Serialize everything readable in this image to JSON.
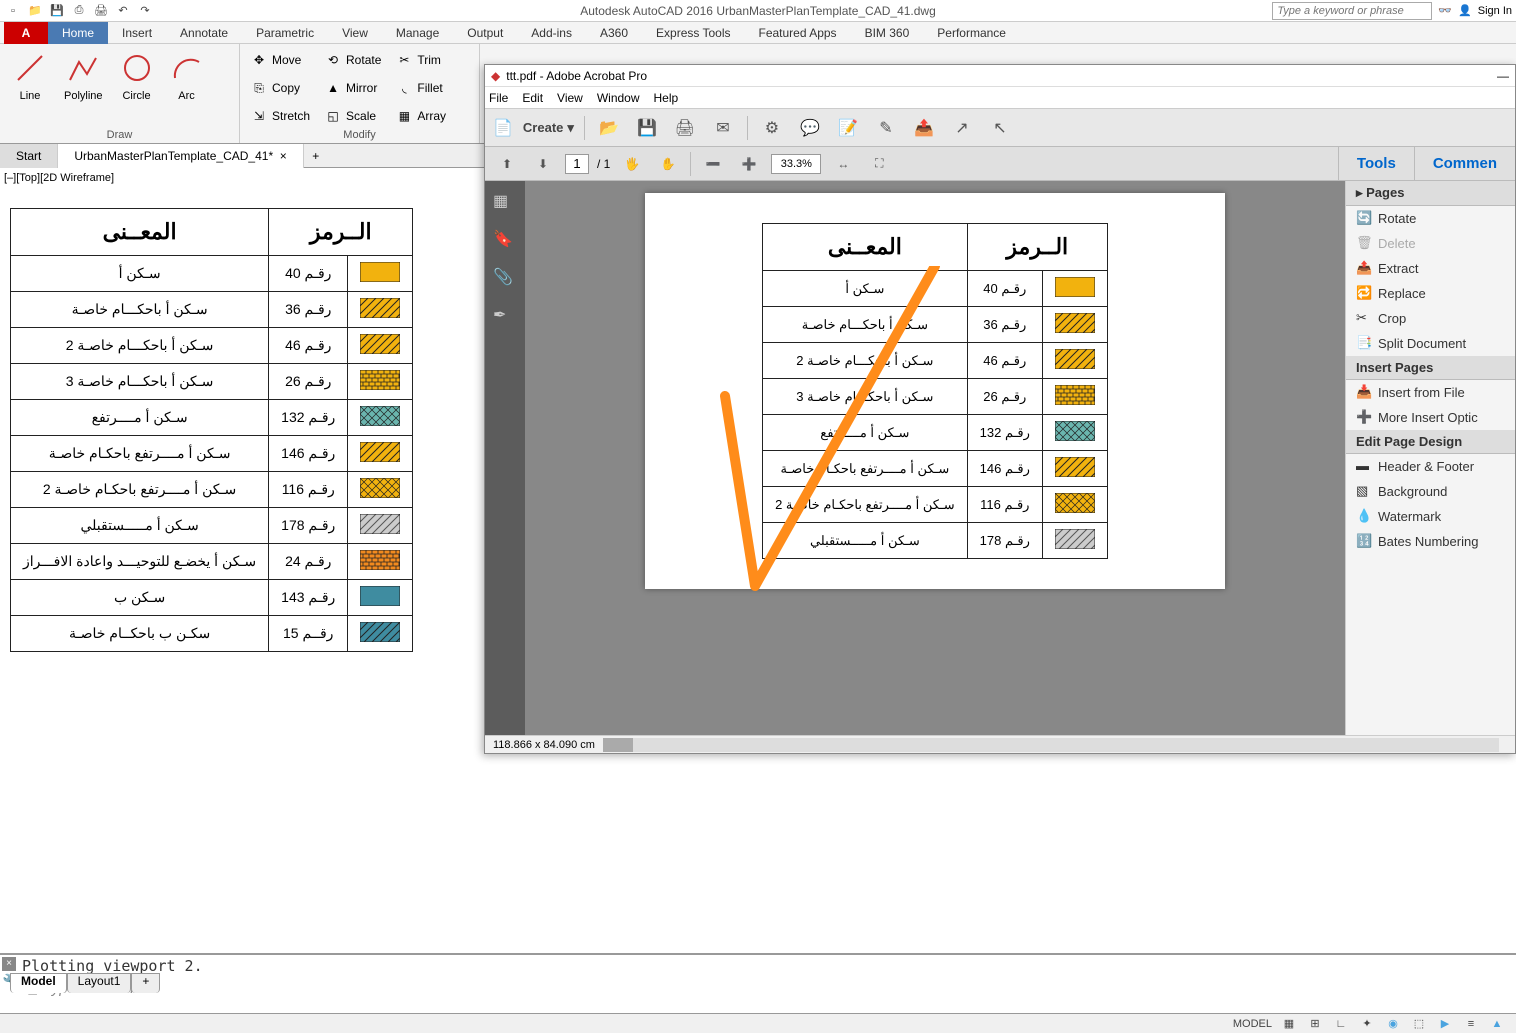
{
  "app": {
    "title": "Autodesk AutoCAD 2016   UrbanMasterPlanTemplate_CAD_41.dwg",
    "search_placeholder": "Type a keyword or phrase",
    "signin": "Sign In"
  },
  "ribbon": {
    "tabs": [
      "Home",
      "Insert",
      "Annotate",
      "Parametric",
      "View",
      "Manage",
      "Output",
      "Add-ins",
      "A360",
      "Express Tools",
      "Featured Apps",
      "BIM 360",
      "Performance"
    ],
    "draw": {
      "line": "Line",
      "polyline": "Polyline",
      "circle": "Circle",
      "arc": "Arc",
      "label": "Draw"
    },
    "modify": {
      "move": "Move",
      "rotate": "Rotate",
      "trim": "Trim",
      "copy": "Copy",
      "mirror": "Mirror",
      "fillet": "Fillet",
      "stretch": "Stretch",
      "scale": "Scale",
      "array": "Array",
      "label": "Modify"
    }
  },
  "files": {
    "start": "Start",
    "doc": "UrbanMasterPlanTemplate_CAD_41*"
  },
  "ucs": "[‒][Top][2D Wireframe]",
  "legend": {
    "h_meaning": "المعــنى",
    "h_symbol": "الــرمز",
    "rows": [
      {
        "m": "سـكن أ",
        "c": "رقـم 40",
        "sw": "#f2b20e"
      },
      {
        "m": "سـكن أ  باحكـــام خاصـة",
        "c": "رقـم 36",
        "sw": "hatch-yellow"
      },
      {
        "m": "سـكن أ  باحكـــام خاصـة 2",
        "c": "رقـم 46",
        "sw": "hatch-yellow"
      },
      {
        "m": "سـكن أ  باحكـــام خاصـة 3",
        "c": "رقـم 26",
        "sw": "brick-yellow"
      },
      {
        "m": "سـكن أ مــــرتفع",
        "c": "رقـم 132",
        "sw": "cross-teal"
      },
      {
        "m": "سـكن أ مــــرتفع باحكـام خاصـة",
        "c": "رقـم 146",
        "sw": "hatch-yellow"
      },
      {
        "m": "سـكن أ مــــرتفع باحكـام خاصـة 2",
        "c": "رقـم 116",
        "sw": "cross-yellow"
      },
      {
        "m": "سـكن أ مـــــستقبلي",
        "c": "رقـم 178",
        "sw": "hatch-gray"
      },
      {
        "m": "سـكن أ يخضـع للتوحيـــد واعادة الافـــراز",
        "c": "رقـم 24",
        "sw": "brick-orange"
      },
      {
        "m": "سـكن ب",
        "c": "رقـم 143",
        "sw": "#3f8ca0"
      },
      {
        "m": "سكـن ب باحكــام خاصـة",
        "c": "رقــم 15",
        "sw": "hatch-teal"
      }
    ]
  },
  "pdf_legend": {
    "rows": [
      {
        "m": "سـكن أ",
        "c": "رقـم 40",
        "sw": "#f2b20e"
      },
      {
        "m": "سـكن أ  باحكـــام خاصـة",
        "c": "رقـم 36",
        "sw": "hatch-yellow"
      },
      {
        "m": "سـكن أ  باحكـــام خاصـة 2",
        "c": "رقـم 46",
        "sw": "hatch-yellow"
      },
      {
        "m": "سـكن أ  باحكـــام خاصـة 3",
        "c": "رقـم 26",
        "sw": "brick-yellow"
      },
      {
        "m": "سـكن أ مــــرتفع",
        "c": "رقـم 132",
        "sw": "cross-teal"
      },
      {
        "m": "سـكن أ مــــرتفع باحكـام خاصـة",
        "c": "رقـم 146",
        "sw": "hatch-yellow"
      },
      {
        "m": "سـكن أ مــــرتفع باحكـام خاصـة 2",
        "c": "رقـم 116",
        "sw": "cross-yellow"
      },
      {
        "m": "سـكن أ مـــــستقبلي",
        "c": "رقـم 178",
        "sw": "hatch-gray"
      }
    ]
  },
  "cmd": {
    "out": "Plotting viewport 2.",
    "placeholder": "Type a command"
  },
  "layout": {
    "model": "Model",
    "layout1": "Layout1"
  },
  "status": {
    "model": "MODEL"
  },
  "acrobat": {
    "title": "ttt.pdf - Adobe Acrobat Pro",
    "menu": [
      "File",
      "Edit",
      "View",
      "Window",
      "Help"
    ],
    "create": "Create",
    "page_cur": "1",
    "page_tot": "/ 1",
    "zoom": "33.3%",
    "tools": "Tools",
    "comment": "Commen",
    "pages_hdr": "Pages",
    "pages_items": [
      "Rotate",
      "Delete",
      "Extract",
      "Replace",
      "Crop",
      "Split Document"
    ],
    "insert_hdr": "Insert Pages",
    "insert_items": [
      "Insert from File",
      "More Insert Optic"
    ],
    "design_hdr": "Edit Page Design",
    "design_items": [
      "Header & Footer",
      "Background",
      "Watermark",
      "Bates Numbering"
    ],
    "status": "118.866 x 84.090 cm"
  }
}
